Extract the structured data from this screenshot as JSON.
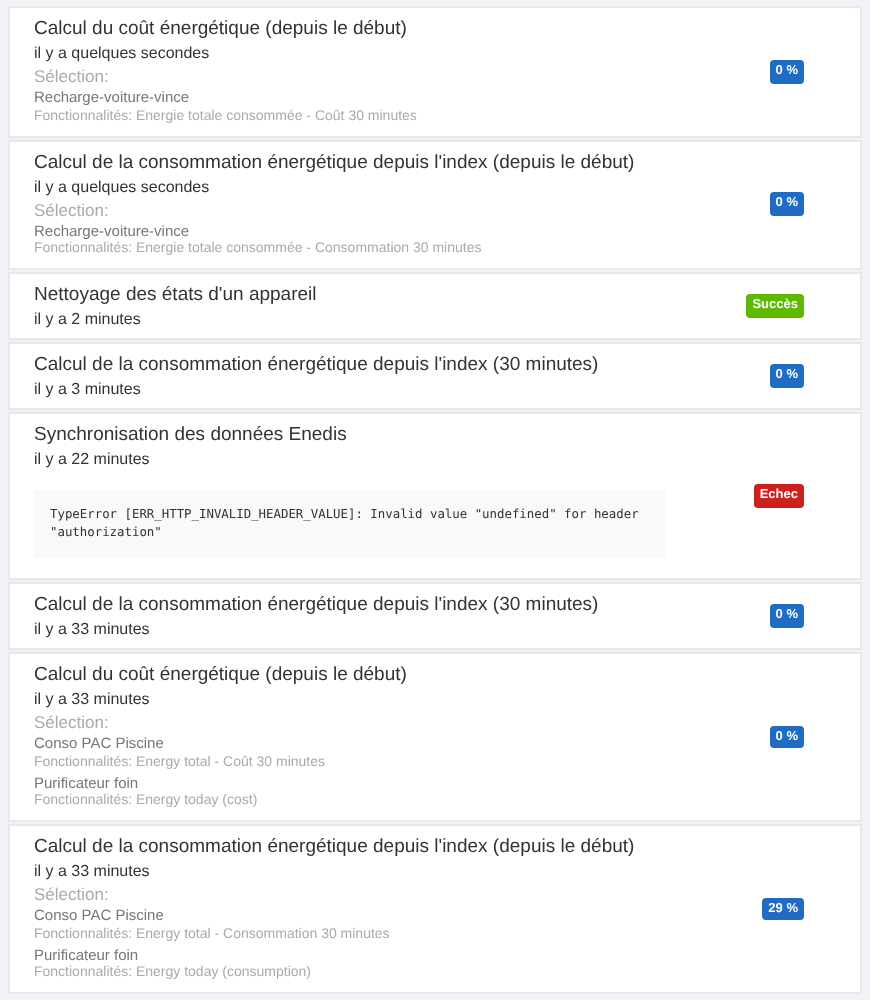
{
  "jobs": [
    {
      "title": "Calcul du coût énergétique (depuis le début)",
      "time": "il y a quelques secondes",
      "selection_label": "Sélection:",
      "devices": [
        {
          "name": "Recharge-voiture-vince",
          "features": "Fonctionnalités: Energie totale consommée - Coût 30 minutes"
        }
      ],
      "badge": {
        "text": "0 %",
        "color": "#206bc4"
      }
    },
    {
      "title": "Calcul de la consommation énergétique depuis l'index (depuis le début)",
      "time": "il y a quelques secondes",
      "selection_label": "Sélection:",
      "devices": [
        {
          "name": "Recharge-voiture-vince",
          "features": "Fonctionnalités: Energie totale consommée - Consommation 30 minutes"
        }
      ],
      "badge": {
        "text": "0 %",
        "color": "#206bc4"
      }
    },
    {
      "title": "Nettoyage des états d'un appareil",
      "time": "il y a 2 minutes",
      "badge": {
        "text": "Succès",
        "color": "#5eba00"
      }
    },
    {
      "title": "Calcul de la consommation énergétique depuis l'index (30 minutes)",
      "time": "il y a 3 minutes",
      "badge": {
        "text": "0 %",
        "color": "#206bc4"
      }
    },
    {
      "title": "Synchronisation des données Enedis",
      "time": "il y a 22 minutes",
      "error": "TypeError [ERR_HTTP_INVALID_HEADER_VALUE]: Invalid value \"undefined\" for header \"authorization\"",
      "badge": {
        "text": "Echec",
        "color": "#cd201f"
      }
    },
    {
      "title": "Calcul de la consommation énergétique depuis l'index (30 minutes)",
      "time": "il y a 33 minutes",
      "badge": {
        "text": "0 %",
        "color": "#206bc4"
      }
    },
    {
      "title": "Calcul du coût énergétique (depuis le début)",
      "time": "il y a 33 minutes",
      "selection_label": "Sélection:",
      "devices": [
        {
          "name": "Conso PAC Piscine",
          "features": "Fonctionnalités: Energy total - Coût 30 minutes"
        },
        {
          "name": "Purificateur foin",
          "features": "Fonctionnalités: Energy today (cost)"
        }
      ],
      "badge": {
        "text": "0 %",
        "color": "#206bc4"
      }
    },
    {
      "title": "Calcul de la consommation énergétique depuis l'index (depuis le début)",
      "time": "il y a 33 minutes",
      "selection_label": "Sélection:",
      "devices": [
        {
          "name": "Conso PAC Piscine",
          "features": "Fonctionnalités: Energy total - Consommation 30 minutes"
        },
        {
          "name": "Purificateur foin",
          "features": "Fonctionnalités: Energy today (consumption)"
        }
      ],
      "badge": {
        "text": "29 %",
        "color": "#206bc4"
      }
    }
  ]
}
